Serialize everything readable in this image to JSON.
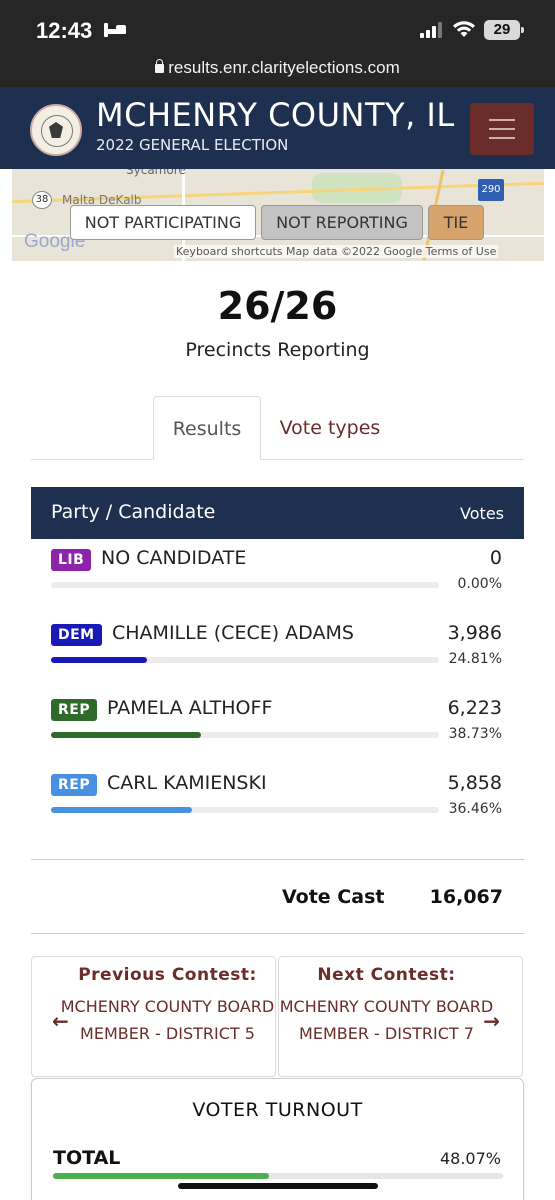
{
  "status_bar": {
    "time": "12:43",
    "battery": "29"
  },
  "url": "results.enr.clarityelections.com",
  "header": {
    "title": "MCHENRY COUNTY, IL",
    "subtitle": "2022 GENERAL ELECTION"
  },
  "map": {
    "towns": [
      "Sycamore",
      "Malta  DeKalb"
    ],
    "shields": [
      "38",
      "290"
    ],
    "google": "Google",
    "attribution": "Keyboard shortcuts   Map data ©2022 Google   Terms of Use",
    "legend": [
      "NOT PARTICIPATING",
      "NOT REPORTING",
      "TIE"
    ]
  },
  "precincts": {
    "count": "26/26",
    "label": "Precincts Reporting"
  },
  "tabs": [
    {
      "label": "Results",
      "active": true
    },
    {
      "label": "Vote types",
      "active": false
    }
  ],
  "table": {
    "header_party": "Party / Candidate",
    "header_votes": "Votes",
    "rows": [
      {
        "party": "LIB",
        "party_color": "#8e24aa",
        "name": "NO CANDIDATE",
        "votes": "0",
        "pct": "0.00%",
        "fraction": 0.0,
        "bar_color": "#8e24aa"
      },
      {
        "party": "DEM",
        "party_color": "#1a19b8",
        "name": "CHAMILLE (CECE) ADAMS",
        "votes": "3,986",
        "pct": "24.81%",
        "fraction": 0.2481,
        "bar_color": "#1a19b8"
      },
      {
        "party": "REP",
        "party_color": "#2e6b2a",
        "name": "PAMELA ALTHOFF",
        "votes": "6,223",
        "pct": "38.73%",
        "fraction": 0.3873,
        "bar_color": "#2e6b2a"
      },
      {
        "party": "REP",
        "party_color": "#4a90e2",
        "name": "CARL KAMIENSKI",
        "votes": "5,858",
        "pct": "36.46%",
        "fraction": 0.3646,
        "bar_color": "#4a90e2"
      }
    ]
  },
  "vote_cast": {
    "label": "Vote Cast",
    "value": "16,067"
  },
  "nav": {
    "prev_title": "Previous Contest:",
    "prev_name": "MCHENRY COUNTY BOARD MEMBER - DISTRICT 5",
    "next_title": "Next Contest:",
    "next_name": "MCHENRY COUNTY BOARD MEMBER - DISTRICT 7"
  },
  "turnout": {
    "title": "VOTER TURNOUT",
    "label": "TOTAL",
    "pct": "48.07%",
    "fraction": 0.4807
  }
}
